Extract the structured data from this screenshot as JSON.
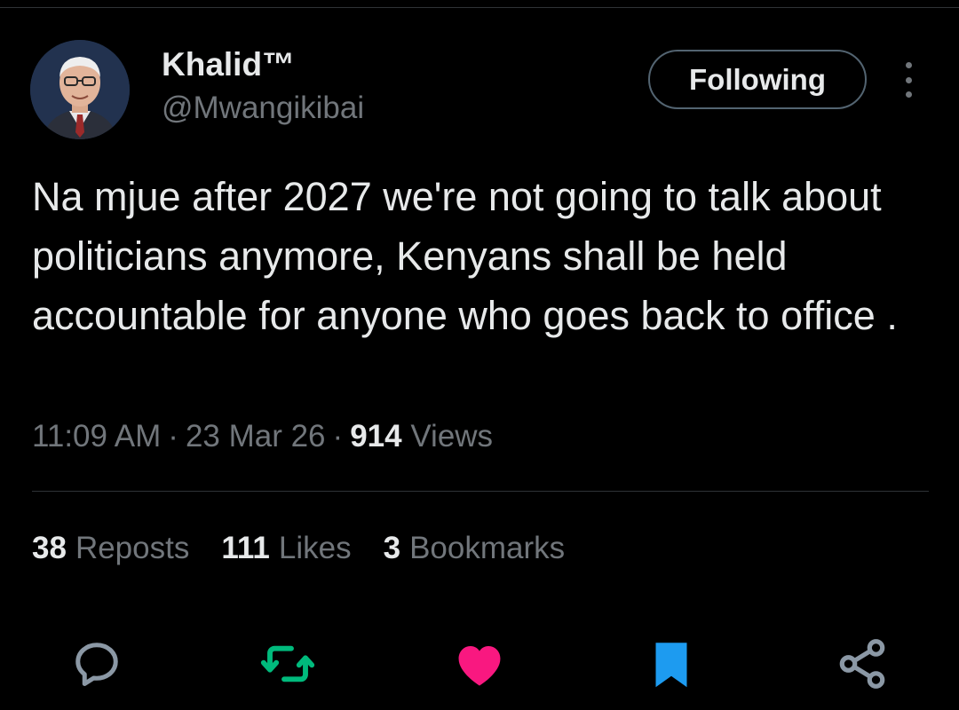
{
  "author": {
    "display_name": "Khalid™",
    "handle": "@Mwangikibai"
  },
  "follow_button": {
    "label": "Following"
  },
  "tweet": {
    "text": "Na mjue after 2027 we're not going to talk about politicians anymore, Kenyans shall be held accountable for anyone who goes back to office ."
  },
  "meta": {
    "time": "11:09 AM",
    "date": "23 Mar 26",
    "views_count": "914",
    "views_label": "Views",
    "separator": "·"
  },
  "stats": {
    "reposts": {
      "count": "38",
      "label": "Reposts"
    },
    "likes": {
      "count": "111",
      "label": "Likes"
    },
    "bookmarks": {
      "count": "3",
      "label": "Bookmarks"
    }
  },
  "actions": [
    {
      "icon": "reply-icon",
      "color": "#8b98a5"
    },
    {
      "icon": "repost-icon",
      "color": "#00ba7c"
    },
    {
      "icon": "like-icon",
      "color": "#f91880"
    },
    {
      "icon": "bookmark-icon",
      "color": "#1d9bf0"
    },
    {
      "icon": "share-icon",
      "color": "#8b98a5"
    }
  ],
  "colors": {
    "background": "#000000",
    "text_primary": "#e7e9ea",
    "text_secondary": "#71767b",
    "border": "#2f3336"
  }
}
